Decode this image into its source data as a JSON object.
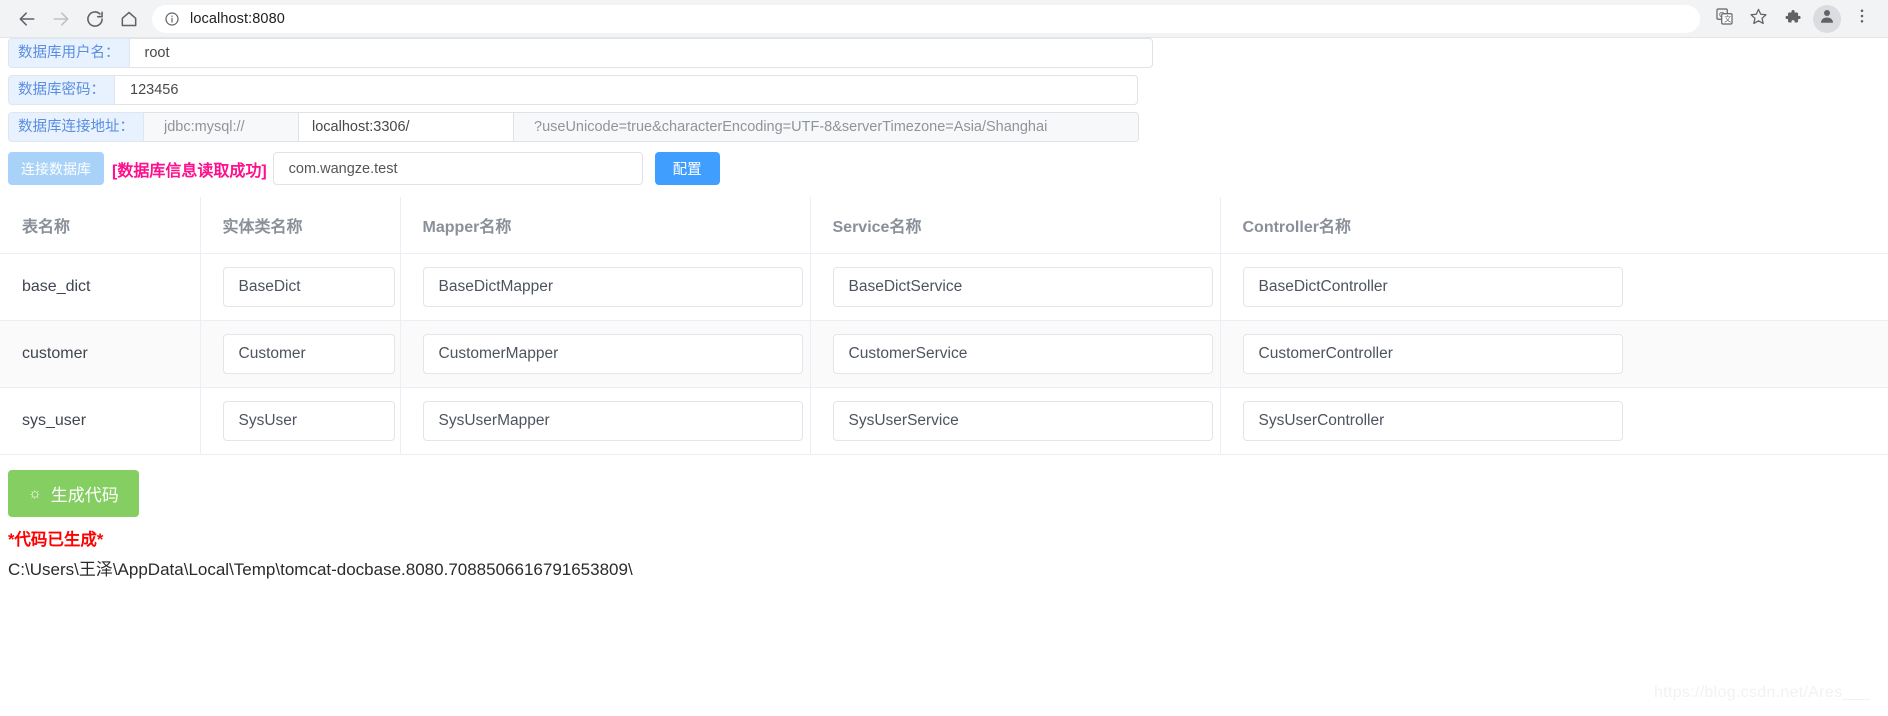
{
  "browser": {
    "back_icon": "back-arrow-icon",
    "forward_icon": "forward-arrow-icon",
    "reload_icon": "reload-icon",
    "home_icon": "home-icon",
    "info_icon": "info-circle-icon",
    "url": "localhost:8080",
    "translate_icon": "translate-icon",
    "bookmark_icon": "star-icon",
    "extensions_icon": "puzzle-icon",
    "profile_icon": "profile-avatar-icon",
    "menu_icon": "three-dot-menu-icon"
  },
  "form": {
    "username": {
      "label": "数据库用户名：",
      "value": "root"
    },
    "password": {
      "label": "数据库密码：",
      "value": "123456"
    },
    "connection": {
      "label": "数据库连接地址：",
      "protocol": "jdbc:mysql://",
      "host": "localhost:3306/",
      "params": "?useUnicode=true&characterEncoding=UTF-8&serverTimezone=Asia/Shanghai"
    }
  },
  "actions": {
    "connect_label": "连接数据库",
    "status_text": "[数据库信息读取成功]",
    "status_color": "#ff0f8c",
    "package_value": "com.wangze.test",
    "config_label": "配置",
    "config_color": "#409eff"
  },
  "table": {
    "headers": [
      "表名称",
      "实体类名称",
      "Mapper名称",
      "Service名称",
      "Controller名称"
    ],
    "rows": [
      {
        "table_name": "base_dict",
        "entity": "BaseDict",
        "mapper": "BaseDictMapper",
        "service": "BaseDictService",
        "controller": "BaseDictController"
      },
      {
        "table_name": "customer",
        "entity": "Customer",
        "mapper": "CustomerMapper",
        "service": "CustomerService",
        "controller": "CustomerController"
      },
      {
        "table_name": "sys_user",
        "entity": "SysUser",
        "mapper": "SysUserMapper",
        "service": "SysUserService",
        "controller": "SysUserController"
      }
    ]
  },
  "generate": {
    "icon": "☼",
    "label": "生成代码",
    "button_color": "#85ce61",
    "message": "*代码已生成*",
    "message_color": "#ff0000",
    "path": "C:\\Users\\王泽\\AppData\\Local\\Temp\\tomcat-docbase.8080.7088506616791653809\\"
  },
  "watermark": "https://blog.csdn.net/Ares___"
}
